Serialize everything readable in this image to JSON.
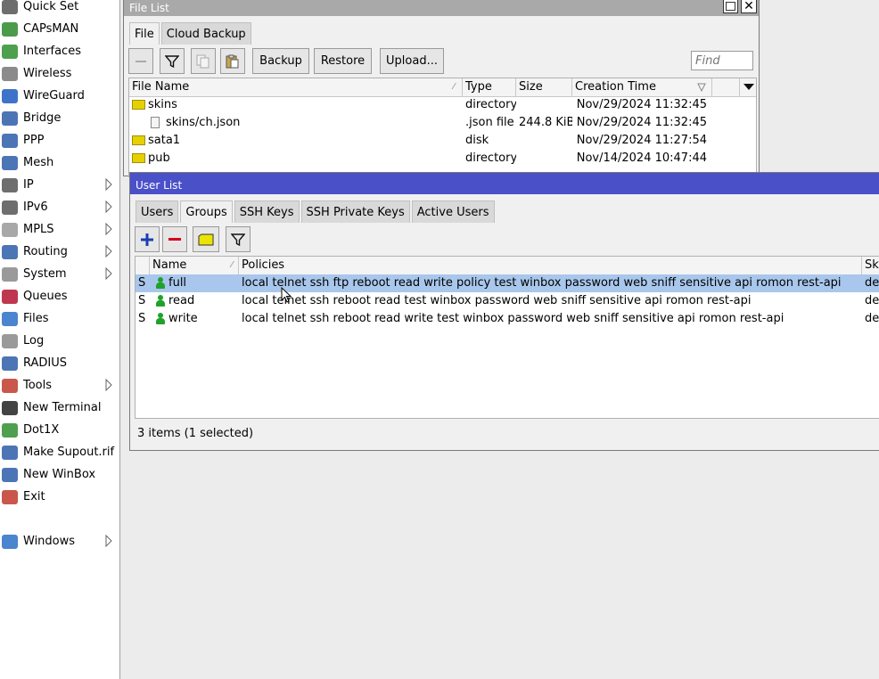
{
  "sidebar": {
    "items": [
      {
        "label": "Quick Set",
        "icon": "quick-set-icon",
        "submenu": false
      },
      {
        "label": "CAPsMAN",
        "icon": "capsman-icon",
        "submenu": false
      },
      {
        "label": "Interfaces",
        "icon": "interfaces-icon",
        "submenu": false
      },
      {
        "label": "Wireless",
        "icon": "wireless-icon",
        "submenu": false
      },
      {
        "label": "WireGuard",
        "icon": "wireguard-icon",
        "submenu": false
      },
      {
        "label": "Bridge",
        "icon": "bridge-icon",
        "submenu": false
      },
      {
        "label": "PPP",
        "icon": "ppp-icon",
        "submenu": false
      },
      {
        "label": "Mesh",
        "icon": "mesh-icon",
        "submenu": false
      },
      {
        "label": "IP",
        "icon": "ip-icon",
        "submenu": true
      },
      {
        "label": "IPv6",
        "icon": "ipv6-icon",
        "submenu": true
      },
      {
        "label": "MPLS",
        "icon": "mpls-icon",
        "submenu": true
      },
      {
        "label": "Routing",
        "icon": "routing-icon",
        "submenu": true
      },
      {
        "label": "System",
        "icon": "system-icon",
        "submenu": true
      },
      {
        "label": "Queues",
        "icon": "queues-icon",
        "submenu": false
      },
      {
        "label": "Files",
        "icon": "files-icon",
        "submenu": false
      },
      {
        "label": "Log",
        "icon": "log-icon",
        "submenu": false
      },
      {
        "label": "RADIUS",
        "icon": "radius-icon",
        "submenu": false
      },
      {
        "label": "Tools",
        "icon": "tools-icon",
        "submenu": true
      },
      {
        "label": "New Terminal",
        "icon": "terminal-icon",
        "submenu": false
      },
      {
        "label": "Dot1X",
        "icon": "dot1x-icon",
        "submenu": false
      },
      {
        "label": "Make Supout.rif",
        "icon": "supout-icon",
        "submenu": false
      },
      {
        "label": "New WinBox",
        "icon": "winbox-icon",
        "submenu": false
      },
      {
        "label": "Exit",
        "icon": "exit-icon",
        "submenu": false
      },
      {
        "label": "Windows",
        "icon": "windows-icon",
        "submenu": true
      }
    ]
  },
  "file_list": {
    "title": "File List",
    "tabs": [
      "File",
      "Cloud Backup"
    ],
    "active_tab": "File",
    "buttons": {
      "backup": "Backup",
      "restore": "Restore",
      "upload": "Upload..."
    },
    "find_placeholder": "Find",
    "columns": [
      "File Name",
      "Type",
      "Size",
      "Creation Time"
    ],
    "rows": [
      {
        "name": "skins",
        "type": "directory",
        "size": "",
        "created": "Nov/29/2024 11:32:45",
        "kind": "folder"
      },
      {
        "name": "skins/ch.json",
        "type": ".json file",
        "size": "244.8 KiB",
        "created": "Nov/29/2024 11:32:45",
        "kind": "file"
      },
      {
        "name": "sata1",
        "type": "disk",
        "size": "",
        "created": "Nov/29/2024 11:27:54",
        "kind": "folder"
      },
      {
        "name": "pub",
        "type": "directory",
        "size": "",
        "created": "Nov/14/2024 10:47:44",
        "kind": "folder"
      }
    ]
  },
  "user_list": {
    "title": "User List",
    "tabs": [
      "Users",
      "Groups",
      "SSH Keys",
      "SSH Private Keys",
      "Active Users"
    ],
    "active_tab": "Groups",
    "columns": [
      "Name",
      "Policies",
      "Ski"
    ],
    "rows": [
      {
        "flag": "S",
        "name": "full",
        "policies": "local telnet ssh ftp reboot read write policy test winbox password web sniff sensitive api romon rest-api",
        "skin": "def",
        "selected": true
      },
      {
        "flag": "S",
        "name": "read",
        "policies": "local telnet ssh reboot read test winbox password web sniff sensitive api romon rest-api",
        "skin": "def",
        "selected": false
      },
      {
        "flag": "S",
        "name": "write",
        "policies": "local telnet ssh reboot read write test winbox password web sniff sensitive api romon rest-api",
        "skin": "def",
        "selected": false
      }
    ],
    "status": "3 items (1 selected)"
  },
  "colors": {
    "title_active": "#4a50c8",
    "title_inactive": "#a9a9a9",
    "selection": "#a9c7ec"
  }
}
